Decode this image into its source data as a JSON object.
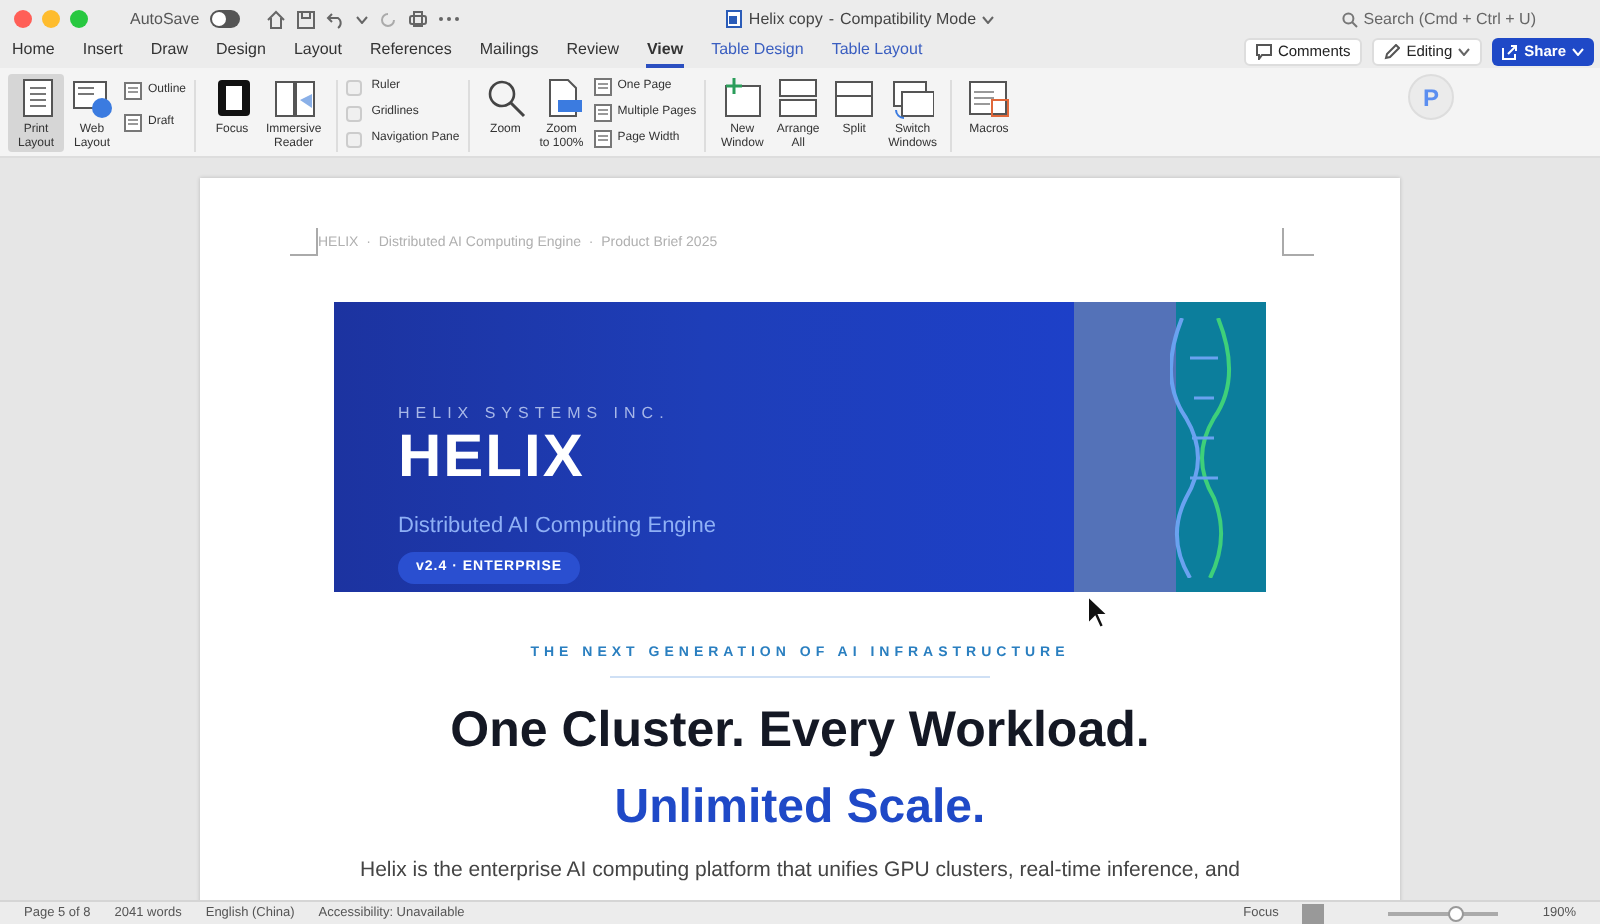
{
  "window": {
    "title": "Helix copy",
    "separator": "-",
    "mode": "Compatibility Mode",
    "autosave": {
      "label": "AutoSave",
      "on": false
    },
    "search": {
      "placeholder": "Search (Cmd + Ctrl + U)"
    }
  },
  "tabs": [
    {
      "label": "Home",
      "kind": "normal",
      "selected": false
    },
    {
      "label": "Insert",
      "kind": "normal",
      "selected": false
    },
    {
      "label": "Draw",
      "kind": "normal",
      "selected": false
    },
    {
      "label": "Design",
      "kind": "normal",
      "selected": false
    },
    {
      "label": "Layout",
      "kind": "normal",
      "selected": false
    },
    {
      "label": "References",
      "kind": "normal",
      "selected": false
    },
    {
      "label": "Mailings",
      "kind": "normal",
      "selected": false
    },
    {
      "label": "Review",
      "kind": "normal",
      "selected": false
    },
    {
      "label": "View",
      "kind": "normal",
      "selected": true
    },
    {
      "label": "Table Design",
      "kind": "contextual",
      "selected": false
    },
    {
      "label": "Table Layout",
      "kind": "contextual",
      "selected": false
    }
  ],
  "actions": {
    "comments": "Comments",
    "editing": "Editing",
    "share": "Share",
    "avatar": "P"
  },
  "ribbon": {
    "views": [
      {
        "label": "Print\nLayout",
        "selected": true
      },
      {
        "label": "Web\nLayout",
        "selected": false
      }
    ],
    "view_small": [
      "Outline",
      "Draft"
    ],
    "immersive": [
      {
        "label": "Focus"
      },
      {
        "label": "Immersive\nReader"
      }
    ],
    "show": [
      {
        "label": "Ruler",
        "checked": false
      },
      {
        "label": "Gridlines",
        "checked": false
      },
      {
        "label": "Navigation Pane",
        "checked": false
      }
    ],
    "zoom": [
      {
        "label": "Zoom"
      },
      {
        "label": "Zoom\nto 100%"
      }
    ],
    "zoom_small": [
      "One Page",
      "Multiple Pages",
      "Page Width"
    ],
    "window": [
      {
        "label": "New\nWindow"
      },
      {
        "label": "Arrange\nAll"
      },
      {
        "label": "Split"
      },
      {
        "label": "Switch\nWindows"
      }
    ],
    "macros": {
      "label": "Macros"
    }
  },
  "document": {
    "header": "HELIX  ·  Distributed AI Computing Engine  ·  Product Brief 2025",
    "banner": {
      "company": "HELIX SYSTEMS INC.",
      "title": "HELIX",
      "subtitle": "Distributed AI Computing Engine",
      "badge": "v2.4 · ENTERPRISE"
    },
    "tagline": "THE NEXT GENERATION OF AI INFRASTRUCTURE",
    "heading": "One Cluster. Every Workload.",
    "subheading": "Unlimited Scale.",
    "body": "Helix is the enterprise AI computing platform that unifies GPU clusters, real-time inference, and"
  },
  "status_bar": {
    "page": "Page 5 of 8",
    "words": "2041 words",
    "language": "English (China)",
    "accessibility": "Accessibility: Unavailable",
    "focus": "Focus",
    "zoom": {
      "level": 0.62,
      "reading": "190%"
    }
  }
}
